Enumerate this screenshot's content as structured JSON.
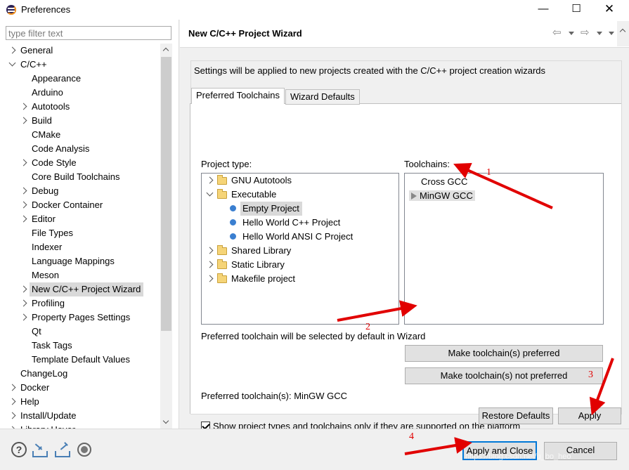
{
  "window": {
    "title": "Preferences",
    "minimize": "—",
    "maximize": "☐",
    "close": "✕"
  },
  "filter": {
    "placeholder": "type filter text",
    "value": ""
  },
  "tree": {
    "items": [
      {
        "label": "General",
        "depth": 0,
        "state": "collapsed"
      },
      {
        "label": "C/C++",
        "depth": 0,
        "state": "expanded"
      },
      {
        "label": "Appearance",
        "depth": 1,
        "state": "leaf"
      },
      {
        "label": "Arduino",
        "depth": 1,
        "state": "leaf"
      },
      {
        "label": "Autotools",
        "depth": 1,
        "state": "collapsed"
      },
      {
        "label": "Build",
        "depth": 1,
        "state": "collapsed"
      },
      {
        "label": "CMake",
        "depth": 1,
        "state": "leaf"
      },
      {
        "label": "Code Analysis",
        "depth": 1,
        "state": "leaf"
      },
      {
        "label": "Code Style",
        "depth": 1,
        "state": "collapsed"
      },
      {
        "label": "Core Build Toolchains",
        "depth": 1,
        "state": "leaf"
      },
      {
        "label": "Debug",
        "depth": 1,
        "state": "collapsed"
      },
      {
        "label": "Docker Container",
        "depth": 1,
        "state": "collapsed"
      },
      {
        "label": "Editor",
        "depth": 1,
        "state": "collapsed"
      },
      {
        "label": "File Types",
        "depth": 1,
        "state": "leaf"
      },
      {
        "label": "Indexer",
        "depth": 1,
        "state": "leaf"
      },
      {
        "label": "Language Mappings",
        "depth": 1,
        "state": "leaf"
      },
      {
        "label": "Meson",
        "depth": 1,
        "state": "leaf"
      },
      {
        "label": "New C/C++ Project Wizard",
        "depth": 1,
        "state": "collapsed",
        "selected": true
      },
      {
        "label": "Profiling",
        "depth": 1,
        "state": "collapsed"
      },
      {
        "label": "Property Pages Settings",
        "depth": 1,
        "state": "collapsed"
      },
      {
        "label": "Qt",
        "depth": 1,
        "state": "leaf"
      },
      {
        "label": "Task Tags",
        "depth": 1,
        "state": "leaf"
      },
      {
        "label": "Template Default Values",
        "depth": 1,
        "state": "leaf"
      },
      {
        "label": "ChangeLog",
        "depth": 0,
        "state": "leaf"
      },
      {
        "label": "Docker",
        "depth": 0,
        "state": "collapsed"
      },
      {
        "label": "Help",
        "depth": 0,
        "state": "collapsed"
      },
      {
        "label": "Install/Update",
        "depth": 0,
        "state": "collapsed"
      },
      {
        "label": "Library Hover",
        "depth": 0,
        "state": "collapsed"
      }
    ]
  },
  "page": {
    "title": "New C/C++ Project Wizard",
    "info": "Settings will be applied to new projects created with the C/C++ project creation wizards",
    "tabs": {
      "preferred": "Preferred Toolchains",
      "wizard_defaults": "Wizard Defaults"
    },
    "project_type_label": "Project type:",
    "toolchains_label": "Toolchains:",
    "project_types": [
      {
        "label": "GNU Autotools",
        "kind": "folder",
        "depth": 0,
        "state": "collapsed"
      },
      {
        "label": "Executable",
        "kind": "folder",
        "depth": 0,
        "state": "expanded"
      },
      {
        "label": "Empty Project",
        "kind": "item",
        "depth": 1,
        "selected": true
      },
      {
        "label": "Hello World C++ Project",
        "kind": "item",
        "depth": 1
      },
      {
        "label": "Hello World ANSI C Project",
        "kind": "item",
        "depth": 1
      },
      {
        "label": "Shared Library",
        "kind": "folder",
        "depth": 0,
        "state": "collapsed"
      },
      {
        "label": "Static Library",
        "kind": "folder",
        "depth": 0,
        "state": "collapsed"
      },
      {
        "label": "Makefile project",
        "kind": "folder",
        "depth": 0,
        "state": "collapsed"
      }
    ],
    "toolchains": [
      {
        "label": "Cross GCC",
        "preferred": false,
        "selected": false
      },
      {
        "label": "MinGW GCC",
        "preferred": true,
        "selected": true
      }
    ],
    "preferred_default_text": "Preferred toolchain will be selected by default in Wizard",
    "make_preferred": "Make toolchain(s) preferred",
    "make_not_preferred": "Make toolchain(s) not preferred",
    "preferred_toolchains": "Preferred toolchain(s): MinGW GCC",
    "platform_checkbox": {
      "label": "Show project types and toolchains only if they are supported on the platform",
      "checked": true
    },
    "restore_defaults": "Restore Defaults",
    "apply": "Apply"
  },
  "footer": {
    "help": "?",
    "apply_close": "Apply and Close",
    "cancel": "Cancel"
  },
  "annotations": [
    "1",
    "2",
    "3",
    "4"
  ],
  "watermark": "https://blog.csdn.net/u_bo_heo",
  "colors": {
    "annotation": "#e10000",
    "default_button_border": "#0078d7",
    "selection": "#d9d9d9",
    "bullet": "#3a7fd0"
  }
}
